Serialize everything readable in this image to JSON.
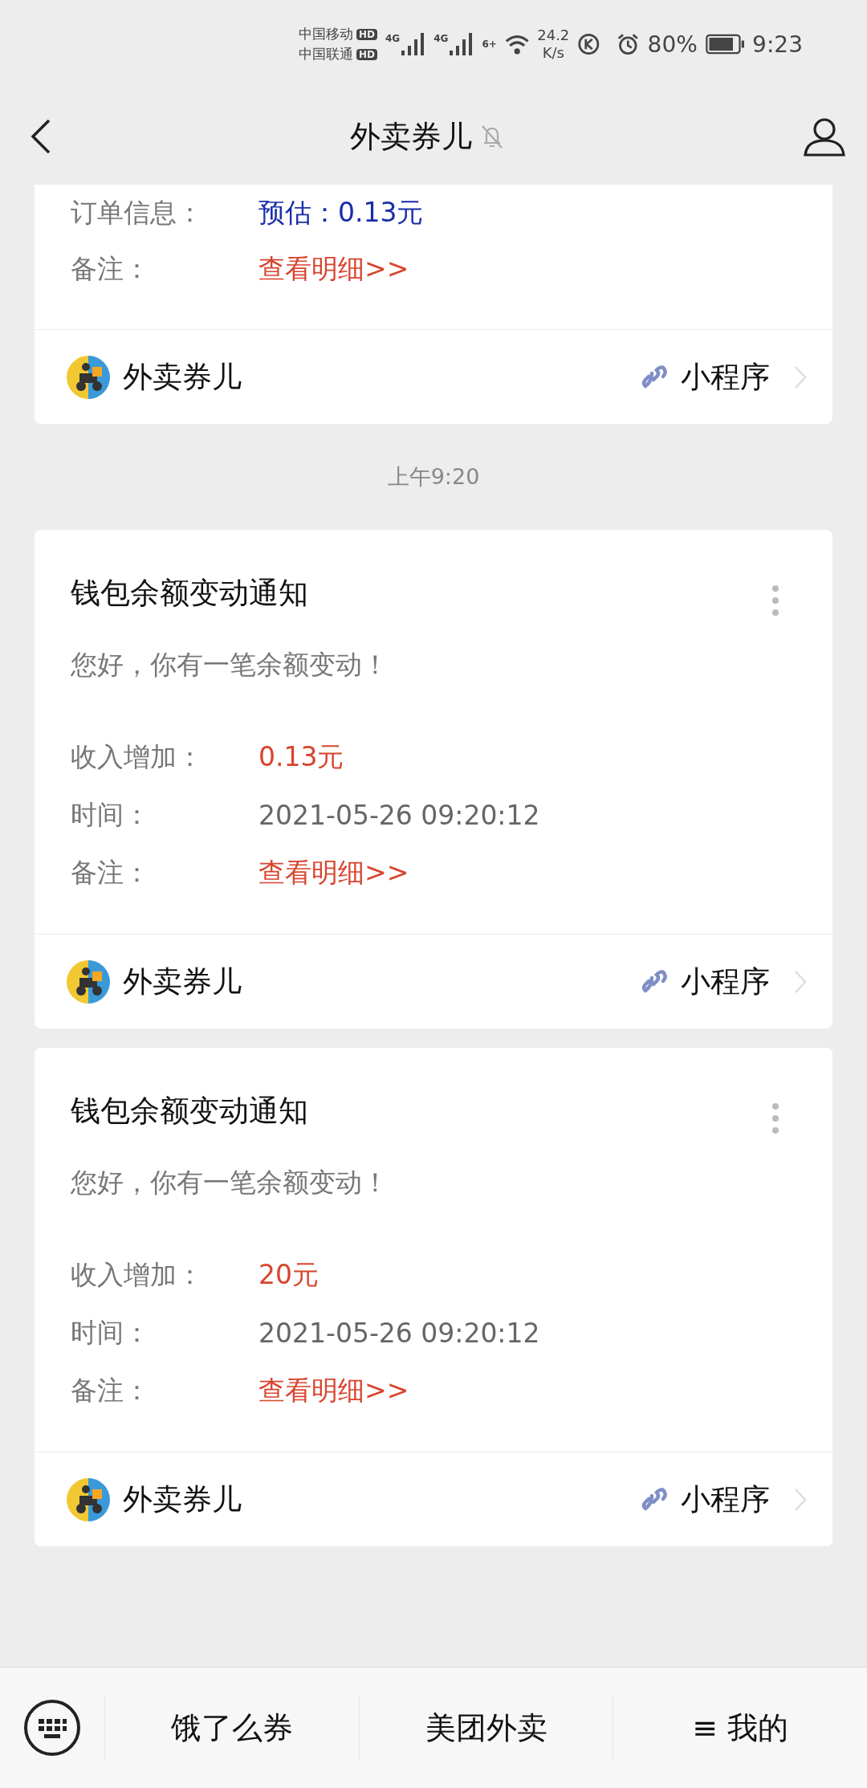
{
  "status_bar": {
    "carriers": [
      {
        "name": "中国移动",
        "badge": "HD"
      },
      {
        "name": "中国联通",
        "badge": "HD"
      }
    ],
    "networks": [
      "4G",
      "4G"
    ],
    "wifi_tag": "6+",
    "speed": "24.2",
    "speed_unit": "K/s",
    "battery": "80%",
    "time": "9:23"
  },
  "header": {
    "title": "外卖券儿",
    "muted": true
  },
  "feed": [
    {
      "kind": "card",
      "partial": true,
      "rows": [
        {
          "label": "订单信息：",
          "value": "预估：0.13元",
          "kind": "estimate"
        },
        {
          "label": "备注：",
          "value": "查看明细>>",
          "kind": "link"
        }
      ],
      "footer": {
        "name": "外卖券儿",
        "tag": "小程序"
      }
    },
    {
      "kind": "time",
      "text": "上午9:20"
    },
    {
      "kind": "card",
      "partial": false,
      "title": "钱包余额变动通知",
      "greeting": "您好，你有一笔余额变动！",
      "rows": [
        {
          "label": "收入增加：",
          "value": "0.13元",
          "kind": "amount"
        },
        {
          "label": "时间：",
          "value": "2021-05-26 09:20:12",
          "kind": "plain"
        },
        {
          "label": "备注：",
          "value": "查看明细>>",
          "kind": "link"
        }
      ],
      "footer": {
        "name": "外卖券儿",
        "tag": "小程序"
      }
    },
    {
      "kind": "card",
      "partial": false,
      "title": "钱包余额变动通知",
      "greeting": "您好，你有一笔余额变动！",
      "rows": [
        {
          "label": "收入增加：",
          "value": "20元",
          "kind": "amount"
        },
        {
          "label": "时间：",
          "value": "2021-05-26 09:20:12",
          "kind": "plain"
        },
        {
          "label": "备注：",
          "value": "查看明细>>",
          "kind": "link"
        }
      ],
      "footer": {
        "name": "外卖券儿",
        "tag": "小程序"
      }
    }
  ],
  "bottom_menu": [
    {
      "label": "饿了么券"
    },
    {
      "label": "美团外卖"
    },
    {
      "label": "我的",
      "icon": "≡"
    }
  ]
}
